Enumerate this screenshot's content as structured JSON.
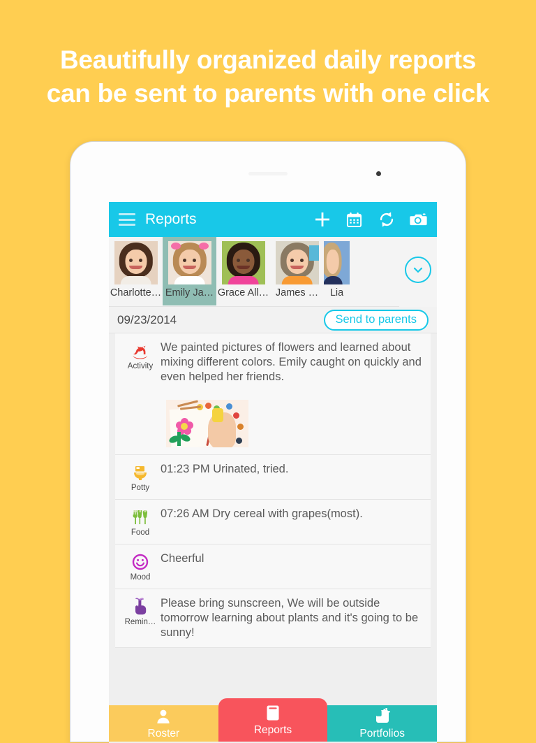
{
  "promo": {
    "headline_line1": "Beautifully organized daily reports",
    "headline_line2": "can be sent to parents with one click",
    "background_color": "#FFCE51",
    "headline_color": "#FFFFFF"
  },
  "app": {
    "accent_color": "#18C8E8",
    "appbar": {
      "menu_icon": "hamburger-icon",
      "title": "Reports",
      "actions": [
        {
          "name": "add-button",
          "icon": "plus-icon"
        },
        {
          "name": "calendar-button",
          "icon": "calendar-icon"
        },
        {
          "name": "sync-button",
          "icon": "sync-icon"
        },
        {
          "name": "camera-button",
          "icon": "camera-icon"
        }
      ]
    },
    "students": {
      "selected_index": 1,
      "selected_color": "#8FBDB3",
      "expand_icon": "chevron-down-icon",
      "items": [
        {
          "name": "Charlotte…",
          "hair": "#4A2E1E",
          "bg": "#E6D2C0",
          "shirt": "#F2EDE6"
        },
        {
          "name": "Emily Ja…",
          "hair": "#B98A55",
          "bg": "#EFE3D8",
          "shirt": "#FFFFFF"
        },
        {
          "name": "Grace All…",
          "hair": "#2A1A12",
          "bg": "#9FBF56",
          "shirt": "#F0449A"
        },
        {
          "name": "James …",
          "hair": "#8A7A63",
          "bg": "#D9D4C6",
          "shirt": "#F89A33"
        },
        {
          "name": "Lia",
          "hair": "#C8A878",
          "bg": "#7EA8D6",
          "shirt": "#23305C"
        }
      ]
    },
    "report": {
      "date": "09/23/2014",
      "send_button_label": "Send to parents",
      "entries": [
        {
          "icon": "rocking-horse-icon",
          "label": "Activity",
          "icon_color": "#E8392F",
          "text": "We painted pictures of flowers and learned about mixing different colors. Emily caught on quickly and even helped her friends.",
          "has_photo": true,
          "photo_alt": "child painting a flower with watercolors"
        },
        {
          "icon": "toilet-icon",
          "label": "Potty",
          "icon_color": "#F5B82E",
          "text": "01:23 PM Urinated, tried.",
          "has_photo": false
        },
        {
          "icon": "utensils-icon",
          "label": "Food",
          "icon_color": "#7DBE3C",
          "text": "07:26 AM Dry cereal with grapes(most).",
          "has_photo": false
        },
        {
          "icon": "smiley-icon",
          "label": "Mood",
          "icon_color": "#C32BC3",
          "text": "Cheerful",
          "has_photo": false
        },
        {
          "icon": "reminder-hand-icon",
          "label": "Remin…",
          "icon_color": "#7B3FA0",
          "text": "Please bring sunscreen, We will be outside tomorrow learning about plants and it's going to be sunny!",
          "has_photo": false
        }
      ]
    },
    "tabs": [
      {
        "label": "Roster",
        "icon": "person-icon",
        "color": "#FBCB5C",
        "active": false
      },
      {
        "label": "Reports",
        "icon": "book-icon",
        "color": "#F8545C",
        "active": true
      },
      {
        "label": "Portfolios",
        "icon": "add-photo-icon",
        "color": "#27BEB7",
        "active": false
      }
    ]
  }
}
